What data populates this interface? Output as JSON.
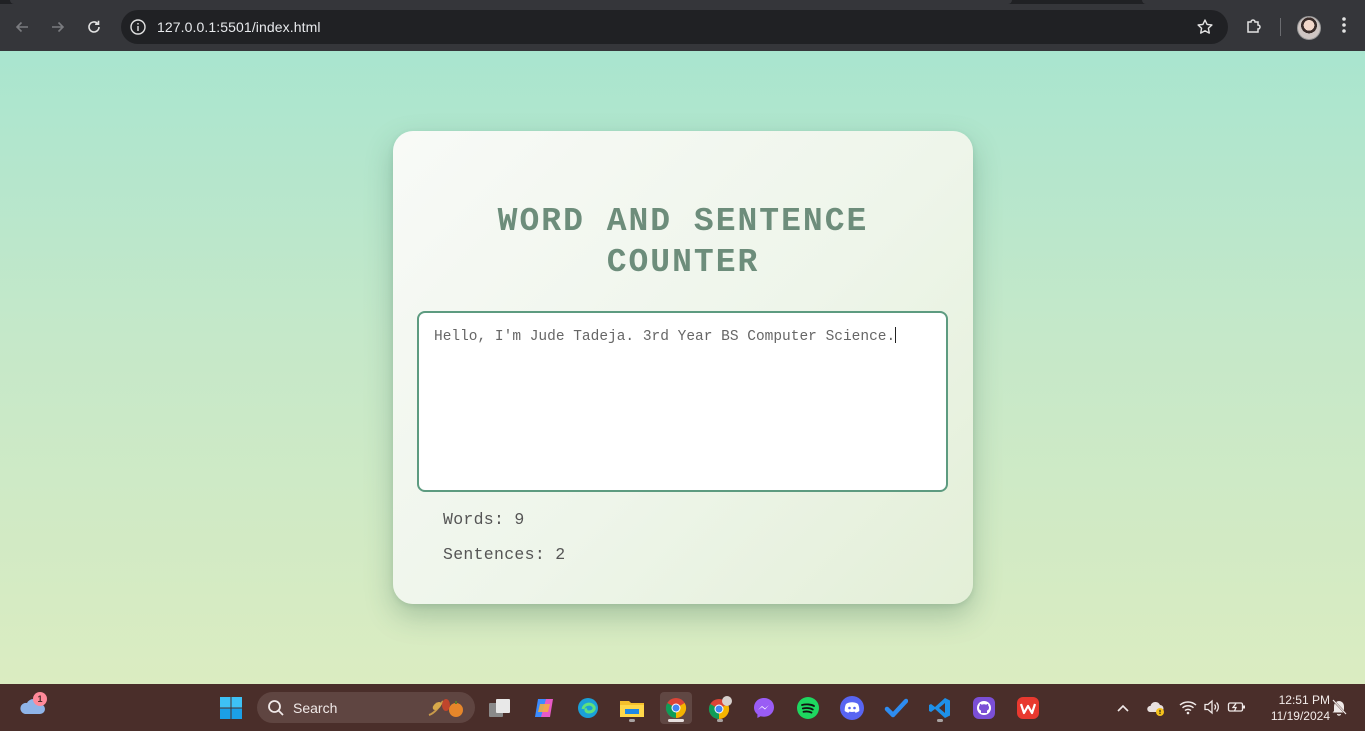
{
  "browser": {
    "url": "127.0.0.1:5501/index.html"
  },
  "app": {
    "title": "WORD AND SENTENCE\nCOUNTER",
    "textarea_value": "Hello, I'm Jude Tadeja. 3rd Year BS Computer Science.",
    "words_label": "Words: 9",
    "sentences_label": "Sentences: 2"
  },
  "taskbar": {
    "search_label": "Search",
    "weather_badge": "1",
    "time": "12:51 PM",
    "date": "11/19/2024",
    "pinned_apps": [
      "start",
      "search",
      "task-view",
      "copilot",
      "edge",
      "file-explorer",
      "chrome",
      "chrome-profile",
      "messenger",
      "spotify",
      "discord",
      "todo",
      "vscode",
      "github-desktop",
      "wps-office"
    ]
  },
  "colors": {
    "title": "#6d8d7b",
    "textarea_border": "#5d9b80",
    "page_gradient_top": "#a9e5cf",
    "page_gradient_bottom": "#dbecc1"
  }
}
